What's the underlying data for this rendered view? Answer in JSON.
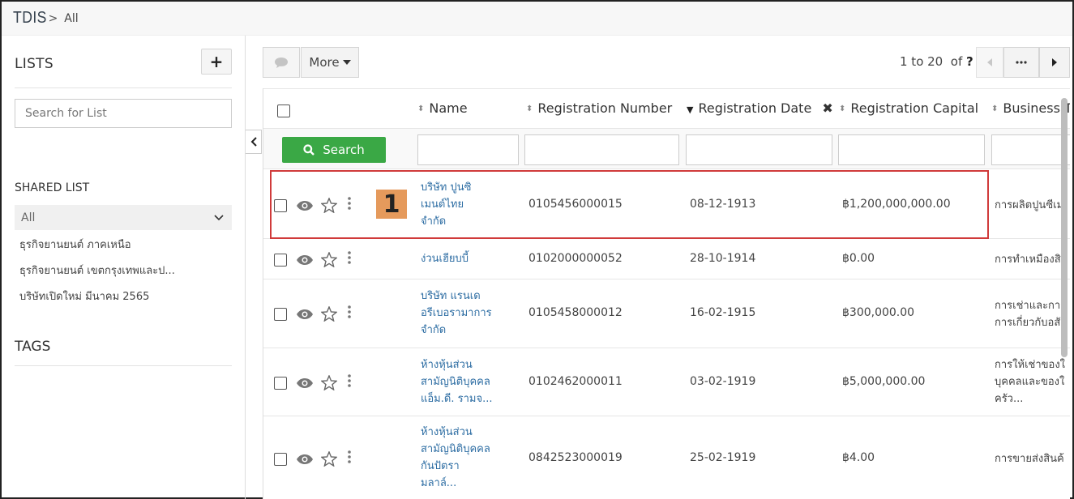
{
  "topbar": {
    "brand": "TDIS",
    "separator": ">",
    "crumb": "All"
  },
  "sidebar": {
    "lists_heading": "LISTS",
    "add_label": "+",
    "search_placeholder": "Search for List",
    "shared_heading": "SHARED LIST",
    "selected_list": "All",
    "items": [
      "ธุรกิจยานยนต์ ภาคเหนือ",
      "ธุรกิจยานยนต์ เขตกรุงเทพและป...",
      "บริษัทเปิดใหม่ มีนาคม 2565"
    ],
    "tags_heading": "TAGS"
  },
  "toolbar": {
    "more_label": "More",
    "pager": {
      "range": "1 to 20",
      "of": "of",
      "total": "?"
    }
  },
  "table": {
    "columns": {
      "name": "Name",
      "reg_number": "Registration Number",
      "reg_date": "Registration Date",
      "reg_capital": "Registration Capital",
      "business": "Business T"
    },
    "search_label": "Search",
    "highlight_badge": "1",
    "rows": [
      {
        "name": [
          "บริษัท ปูนซิ",
          "เมนต์ไทย",
          "จำกัด"
        ],
        "reg_number": "0105456000015",
        "reg_date": "08-12-1913",
        "capital": "฿1,200,000,000.00",
        "business": [
          "การผลิตปูนซีเม"
        ]
      },
      {
        "name": [
          "ง่วนเฮียบบี้"
        ],
        "reg_number": "0102000000052",
        "reg_date": "28-10-1914",
        "capital": "฿0.00",
        "business": [
          "การทำเหมืองสิ"
        ]
      },
      {
        "name": [
          "บริษัท แรนเด",
          "อรีเบอรามาการ",
          "จำกัด"
        ],
        "reg_number": "0105458000012",
        "reg_date": "16-02-1915",
        "capital": "฿300,000.00",
        "business": [
          "การเช่าและการ",
          "การเกี่ยวกับอสั"
        ]
      },
      {
        "name": [
          "ห้างหุ้นส่วน",
          "สามัญนิติบุคคล",
          "แอ็ม.ดี. รามจ..."
        ],
        "reg_number": "0102462000011",
        "reg_date": "03-02-1919",
        "capital": "฿5,000,000.00",
        "business": [
          "การให้เช่าของใ",
          "บุคคลและของใ",
          "ครัว..."
        ]
      },
      {
        "name": [
          "ห้างหุ้นส่วน",
          "สามัญนิติบุคคล",
          "กันปัตรา",
          "มลาล์..."
        ],
        "reg_number": "0842523000019",
        "reg_date": "25-02-1919",
        "capital": "฿4.00",
        "business": [
          "การขายส่งสินค้"
        ]
      }
    ]
  }
}
